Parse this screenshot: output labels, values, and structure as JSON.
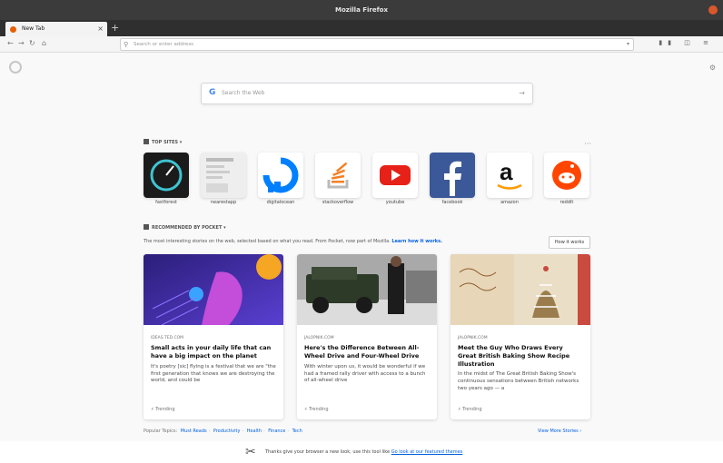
{
  "window": {
    "title": "Mozilla Firefox"
  },
  "tabs": [
    {
      "label": "New Tab"
    }
  ],
  "urlbar": {
    "placeholder": "Search or enter address"
  },
  "search": {
    "placeholder": "Search the Web"
  },
  "top_sites": {
    "header": "Top Sites",
    "sites": [
      {
        "label": "fastforest"
      },
      {
        "label": "nearestapp"
      },
      {
        "label": "digitalocean"
      },
      {
        "label": "stackoverflow"
      },
      {
        "label": "youtube"
      },
      {
        "label": "facebook"
      },
      {
        "label": "amazon"
      },
      {
        "label": "reddit"
      }
    ]
  },
  "pocket": {
    "header": "Recommended by Pocket",
    "subtitle": "The most interesting stories on the web, selected based on what you read. From Pocket, now part of Mozilla.",
    "learn_link": "Learn how it works.",
    "how_button": "How it works",
    "cards": [
      {
        "source": "ideas.ted.com",
        "title": "Small acts in your daily life that can have a big impact on the planet",
        "excerpt": "It's poetry [sic] flying is a festival that we are \"the first generation that knows we are destroying the world, and could be",
        "trending": "Trending"
      },
      {
        "source": "jalopnik.com",
        "title": "Here's the Difference Between All-Wheel Drive and Four-Wheel Drive",
        "excerpt": "With winter upon us, it would be wonderful if we had a framed rally driver with access to a bunch of all-wheel drive",
        "trending": "Trending"
      },
      {
        "source": "jalopnik.com",
        "title": "Meet the Guy Who Draws Every Great British Baking Show Recipe Illustration",
        "excerpt": "In the midst of The Great British Baking Show's continuous sensations between British networks two years ago — a",
        "trending": "Trending"
      }
    ],
    "topics_label": "Popular Topics:",
    "topics": [
      "Must Reads",
      "Productivity",
      "Health",
      "Finance",
      "Tech"
    ],
    "more_stories": "View More Stories"
  },
  "notice": {
    "text": "Thanks give your browser a new look, use this tool like ",
    "link": "Go look at our featured themes"
  }
}
